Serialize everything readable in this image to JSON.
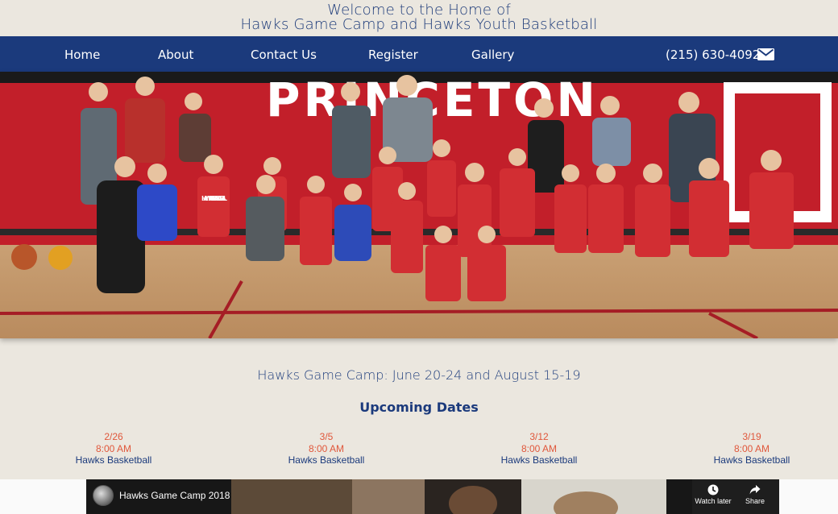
{
  "header": {
    "line1": "Welcome to the Home of",
    "line2": "Hawks Game Camp and Hawks Youth Basketball"
  },
  "nav": {
    "items": [
      "Home",
      "About",
      "Contact Us",
      "Register",
      "Gallery"
    ],
    "phone": "(215) 630-4092",
    "mail_icon": "envelope-icon"
  },
  "hero": {
    "wall_text": "PRINCETON",
    "jersey_text": "HAWKS Youth BASKETBALL"
  },
  "camp_line": "Hawks Game Camp: June 20-24 and August 15-19",
  "upcoming_heading": "Upcoming Dates",
  "events": [
    {
      "date": "2/26",
      "time": "8:00 AM",
      "title": "Hawks Basketball"
    },
    {
      "date": "3/5",
      "time": "8:00 AM",
      "title": "Hawks Basketball"
    },
    {
      "date": "3/12",
      "time": "8:00 AM",
      "title": "Hawks Basketball"
    },
    {
      "date": "3/19",
      "time": "8:00 AM",
      "title": "Hawks Basketball"
    }
  ],
  "video": {
    "title": "Hawks Game Camp 2018",
    "watch_later": "Watch later",
    "share": "Share"
  },
  "colors": {
    "navy": "#1b3a7c",
    "background": "#ebe7df",
    "event_accent": "#e0573b",
    "wall_red": "#c8202b"
  }
}
